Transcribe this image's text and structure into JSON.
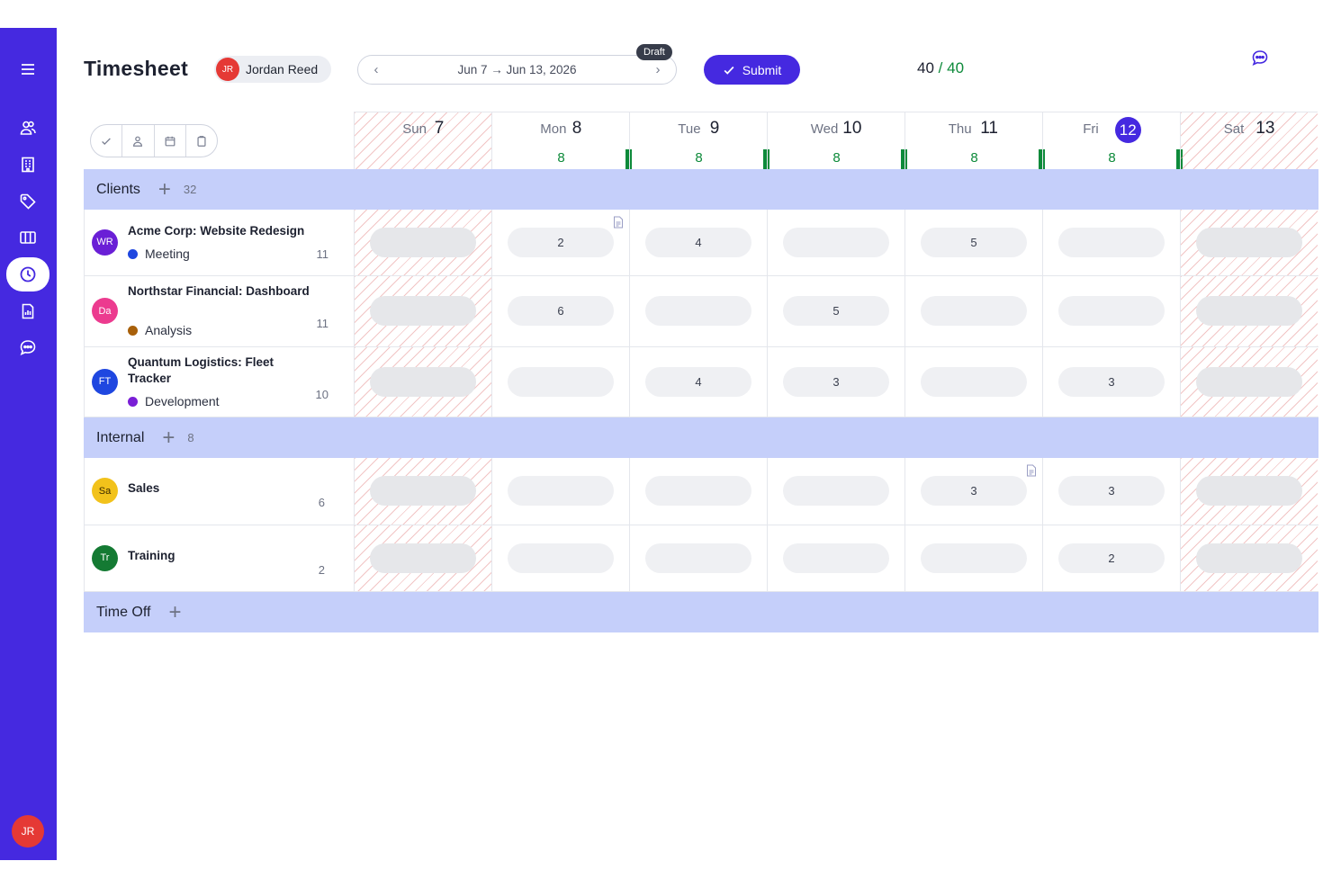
{
  "app": {
    "title": "Timesheet"
  },
  "user": {
    "initials": "JR",
    "name": "Jordan Reed"
  },
  "period": {
    "label": "Jun 7 → Jun 13, 2026",
    "status": "Draft"
  },
  "actions": {
    "submit_label": "Submit"
  },
  "totals": {
    "logged": "40",
    "separator": "/",
    "target": "40"
  },
  "days": [
    {
      "name": "Sun",
      "num": "7",
      "hours": "",
      "weekend": true,
      "today": false
    },
    {
      "name": "Mon",
      "num": "8",
      "hours": "8",
      "weekend": false,
      "today": false
    },
    {
      "name": "Tue",
      "num": "9",
      "hours": "8",
      "weekend": false,
      "today": false
    },
    {
      "name": "Wed",
      "num": "10",
      "hours": "8",
      "weekend": false,
      "today": false
    },
    {
      "name": "Thu",
      "num": "11",
      "hours": "8",
      "weekend": false,
      "today": false
    },
    {
      "name": "Fri",
      "num": "12",
      "hours": "8",
      "weekend": false,
      "today": true
    },
    {
      "name": "Sat",
      "num": "13",
      "hours": "",
      "weekend": true,
      "today": false
    }
  ],
  "sections": {
    "clients": {
      "label": "Clients",
      "count": "32"
    },
    "internal": {
      "label": "Internal",
      "count": "8"
    },
    "timeoff": {
      "label": "Time Off",
      "count": ""
    }
  },
  "rows": [
    {
      "initials": "WR",
      "avatar_color": "#6a1fd6",
      "name": "Acme Corp: Website Redesign",
      "tag": "Meeting",
      "tag_color": "#1f47e0",
      "total": "11",
      "cells": [
        "",
        "2",
        "4",
        "",
        "5",
        "",
        ""
      ],
      "notes": [
        1
      ]
    },
    {
      "initials": "Da",
      "avatar_color": "#ec3b8f",
      "name": "Northstar Financial: Dashboard",
      "tag": "Analysis",
      "tag_color": "#a8600a",
      "total": "11",
      "cells": [
        "",
        "6",
        "",
        "5",
        "",
        "",
        ""
      ],
      "notes": []
    },
    {
      "initials": "FT",
      "avatar_color": "#1f47e0",
      "name": "Quantum Logistics: Fleet Tracker",
      "tag": "Development",
      "tag_color": "#7a1fd6",
      "total": "10",
      "cells": [
        "",
        "",
        "4",
        "3",
        "",
        "3",
        ""
      ],
      "notes": []
    },
    {
      "initials": "Sa",
      "avatar_color": "#f2c21b",
      "avatar_text": "#3b2a00",
      "name": "Sales",
      "tag": "",
      "tag_color": "",
      "total": "6",
      "cells": [
        "",
        "",
        "",
        "",
        "3",
        "3",
        ""
      ],
      "notes": [
        4
      ]
    },
    {
      "initials": "Tr",
      "avatar_color": "#147a33",
      "name": "Training",
      "tag": "",
      "tag_color": "",
      "total": "2",
      "cells": [
        "",
        "",
        "",
        "",
        "",
        "2",
        ""
      ],
      "notes": []
    }
  ],
  "sidebar": [
    "menu-icon",
    "people-icon",
    "building-icon",
    "tag-icon",
    "columns-icon",
    "clock-icon",
    "report-icon",
    "chat-icon"
  ],
  "colors": {
    "brand": "#4529e0",
    "section_bg": "#c5cffa",
    "ok_green": "#0d8a3a"
  }
}
